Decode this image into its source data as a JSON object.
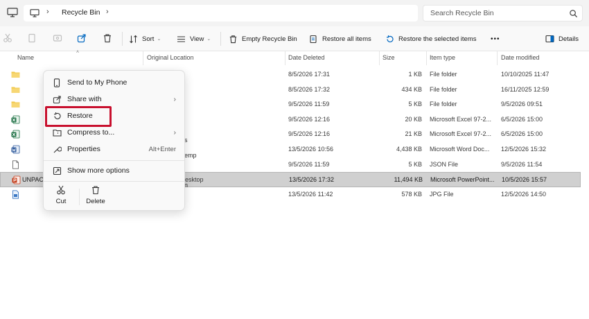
{
  "address": {
    "breadcrumb": "Recycle Bin",
    "search_placeholder": "Search Recycle Bin"
  },
  "toolbar": {
    "sort_label": "Sort",
    "view_label": "View",
    "empty_label": "Empty Recycle Bin",
    "restore_all_label": "Restore all items",
    "restore_selected_label": "Restore the selected items",
    "more_label": "•••",
    "details_label": "Details"
  },
  "columns": {
    "name": "Name",
    "original_location": "Original Location",
    "date_deleted": "Date Deleted",
    "size": "Size",
    "item_type": "Item type",
    "date_modified": "Date modified"
  },
  "rows": [
    {
      "icon": "folder-icon",
      "date_deleted": "8/5/2026 17:31",
      "size": "1 KB",
      "item_type": "File folder",
      "date_modified": "10/10/2025 11:47",
      "selected": false
    },
    {
      "icon": "folder-icon",
      "date_deleted": "8/5/2026 17:32",
      "size": "434 KB",
      "item_type": "File folder",
      "date_modified": "16/11/2025 12:59",
      "selected": false
    },
    {
      "icon": "folder-icon",
      "date_deleted": "9/5/2026 11:59",
      "size": "5 KB",
      "item_type": "File folder",
      "date_modified": "9/5/2026 09:51",
      "selected": false
    },
    {
      "icon": "excel-icon",
      "date_deleted": "9/5/2026 12:16",
      "size": "20 KB",
      "item_type": "Microsoft Excel 97-2...",
      "date_modified": "6/5/2026 15:00",
      "selected": false
    },
    {
      "icon": "excel-icon",
      "date_deleted": "9/5/2026 12:16",
      "size": "21 KB",
      "item_type": "Microsoft Excel 97-2...",
      "date_modified": "6/5/2026 15:00",
      "selected": false
    },
    {
      "icon": "word-icon",
      "date_deleted": "13/5/2026 10:56",
      "size": "4,438 KB",
      "item_type": "Microsoft Word Doc...",
      "date_modified": "12/5/2026 15:32",
      "selected": false
    },
    {
      "icon": "file-icon",
      "date_deleted": "9/5/2026 11:59",
      "size": "5 KB",
      "item_type": "JSON File",
      "date_modified": "9/5/2026 11:54",
      "selected": false
    },
    {
      "icon": "powerpoint-icon",
      "name": "UNPACK",
      "original_location": "esktop",
      "date_deleted": "13/5/2026 17:32",
      "size": "11,494 KB",
      "item_type": "Microsoft PowerPoint...",
      "date_modified": "10/5/2026 15:57",
      "selected": true
    },
    {
      "icon": "image-icon",
      "date_deleted": "13/5/2026 11:42",
      "size": "578 KB",
      "item_type": "JPG File",
      "date_modified": "12/5/2026 14:50",
      "selected": false
    }
  ],
  "ghost_text": {
    "row5_loc": "s",
    "row6_loc": "emp",
    "row8_loc": "n"
  },
  "context_menu": {
    "send_to_phone": "Send to My Phone",
    "share_with": "Share with",
    "restore": "Restore",
    "compress_to": "Compress to...",
    "properties": "Properties",
    "properties_accel": "Alt+Enter",
    "show_more": "Show more options",
    "cut": "Cut",
    "delete": "Delete"
  },
  "colors": {
    "highlight_red": "#c8102e",
    "folder_yellow": "#f2c94c",
    "excel_green": "#1d7044",
    "word_blue": "#2b579a",
    "powerpoint_red": "#c43e1c",
    "accent_blue": "#0067c0"
  }
}
